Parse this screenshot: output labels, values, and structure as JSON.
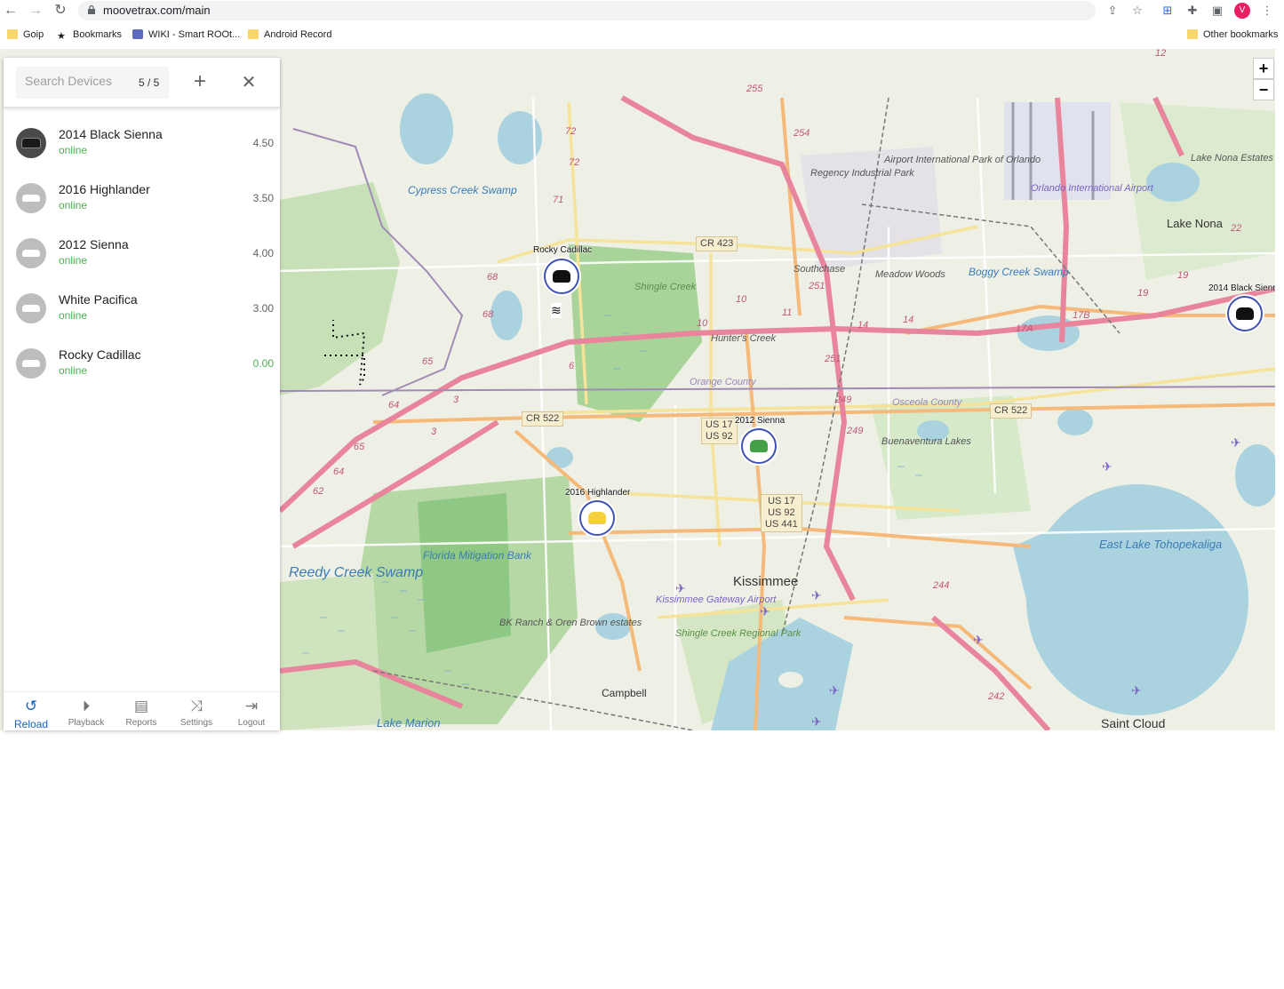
{
  "browser": {
    "url": "moovetrax.com/main",
    "avatar_letter": "V",
    "bookmarks": [
      {
        "label": "Goip",
        "icon": "folder-icon"
      },
      {
        "label": "Bookmarks",
        "icon": "star-icon"
      },
      {
        "label": "WIKI - Smart ROOt...",
        "icon": "wiki-favicon"
      },
      {
        "label": "Android Record",
        "icon": "folder-icon"
      }
    ],
    "other_bookmarks": "Other bookmarks"
  },
  "search": {
    "placeholder": "Search Devices",
    "count": "5 / 5",
    "add_label": "+",
    "close_label": "✕"
  },
  "devices": [
    {
      "name": "2014 Black Sienna",
      "status": "online",
      "value": "4.50",
      "avatar": "photo"
    },
    {
      "name": "2016 Highlander",
      "status": "online",
      "value": "3.50",
      "avatar": "car-icon"
    },
    {
      "name": "2012 Sienna",
      "status": "online",
      "value": "4.00",
      "avatar": "car-icon"
    },
    {
      "name": "White Pacifica",
      "status": "online",
      "value": "3.00",
      "avatar": "car-icon"
    },
    {
      "name": "Rocky Cadillac",
      "status": "online",
      "value": "0.00",
      "avatar": "car-icon"
    }
  ],
  "bottom_nav": [
    {
      "label": "Reload",
      "icon": "reload-icon",
      "active": true
    },
    {
      "label": "Playback",
      "icon": "play-circle-icon",
      "active": false
    },
    {
      "label": "Reports",
      "icon": "document-icon",
      "active": false
    },
    {
      "label": "Settings",
      "icon": "shuffle-icon",
      "active": false
    },
    {
      "label": "Logout",
      "icon": "logout-icon",
      "active": false
    }
  ],
  "map": {
    "zoom_in": "+",
    "zoom_out": "−",
    "markers": [
      {
        "label": "Rocky Cadillac",
        "car_color": "#111111"
      },
      {
        "label": "2014 Black Sienn",
        "car_color": "#111111"
      },
      {
        "label": "2012 Sienna",
        "car_color": "#43a047"
      },
      {
        "label": "2016 Highlander",
        "car_color": "#f4d03f"
      }
    ],
    "places": {
      "kissimmee": "Kissimmee",
      "saint_cloud": "Saint Cloud",
      "lake_nona": "Lake Nona",
      "lake_nona_estates": "Lake Nona Estates",
      "east_lake": "East Lake Tohopekaliga",
      "reedy_creek": "Reedy Creek Swamp",
      "cypress_creek": "Cypress Creek Swamp",
      "shingle_creek": "Shingle Creek",
      "hunters_creek": "Hunter's Creek",
      "southchase": "Southchase",
      "meadow_woods": "Meadow Woods",
      "boggy_creek": "Boggy Creek Swamp",
      "regency": "Regency Industrial Park",
      "airport_park": "Airport International Park of Orlando",
      "orlando_airport": "Orlando International Airport",
      "orange_county": "Orange County",
      "osceola_county": "Osceola County",
      "buenaventura": "Buenaventura Lakes",
      "florida_mitigation": "Florida Mitigation Bank",
      "bk_ranch": "BK Ranch & Oren Brown estates",
      "kissimmee_gateway": "Kissimmee Gateway Airport",
      "shingle_regional": "Shingle Creek Regional Park",
      "campbell": "Campbell",
      "lake_marion": "Lake Marion"
    },
    "shields": {
      "cr423": "CR 423",
      "cr522_left": "CR 522",
      "cr522_right": "CR 522",
      "us17_a": "US 17\nUS 92",
      "us17_b": "US 17\nUS 92\nUS 441"
    }
  }
}
